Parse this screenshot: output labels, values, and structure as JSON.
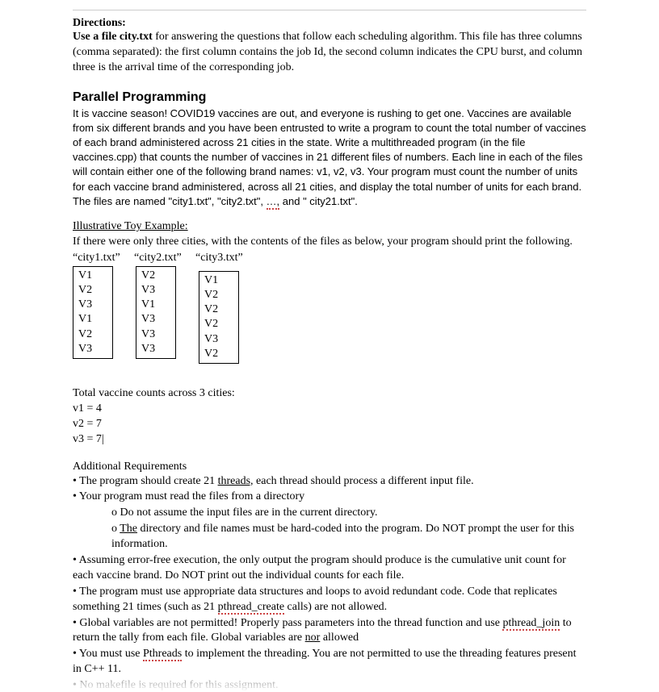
{
  "directions": {
    "heading": "Directions:",
    "body": "Use a file city.txt for answering the questions that follow each scheduling algorithm. This file has three columns (comma separated): the first column contains the job Id, the second column indicates the CPU burst, and column three is the arrival time of the corresponding job."
  },
  "section": {
    "title": "Parallel Programming",
    "body_a": "It is vaccine season! COVID19 vaccines are out, and everyone is rushing to get one. Vaccines are available from six different brands and you have been entrusted to write a program to count the total number of vaccines of each brand administered across 21 cities in the state. Write a multithreaded program (in the file vaccines.cpp) that counts the number of vaccines in 21 different files of numbers. Each line in each of the files will contain either one of the following brand names: v1, v2, v3. Your program must count the number of units for each vaccine brand administered, across all 21 cities, and display the total number of units for each brand. The files are named \"city1.txt\", \"city2.txt\", ",
    "body_ellipsis": "…,",
    "body_b": " and \" city21.txt\"."
  },
  "example": {
    "heading": "Illustrative Toy Example:",
    "intro": "If there were only three cities, with the contents of the files as below, your program should print the following.",
    "labels": [
      "“city1.txt”",
      "“city2.txt”",
      "“city3.txt”"
    ],
    "files": {
      "city1": [
        "V1",
        "V2",
        "V3",
        "V1",
        "V2",
        "V3"
      ],
      "city2": [
        "V2",
        "V3",
        "V1",
        "V3",
        "V3",
        "V3"
      ],
      "city3": [
        "V1",
        "V2",
        "V2",
        "V2",
        "V3",
        "V2"
      ]
    }
  },
  "totals": {
    "heading": "Total vaccine counts across 3 cities:",
    "lines": [
      "v1 = 4",
      "v2 = 7",
      "v3 = 7"
    ]
  },
  "addl": {
    "heading": "Additional Requirements",
    "r1_a": "• The program should create 21 ",
    "r1_thr": "threads,",
    "r1_b": " each thread should process a different input file.",
    "r2": "• Your program must read the files from a directory",
    "r2_o1": "o Do not assume the input files are in the current directory.",
    "r2_o2_a": "o ",
    "r2_o2_the": "The",
    "r2_o2_b": " directory and file names must be hard-coded into the program. Do NOT prompt the user for this information.",
    "r3": "• Assuming error-free execution, the only output the program should produce is the cumulative unit count for each vaccine brand. Do NOT print out the individual counts for each file.",
    "r4_a": "• The program must use appropriate data structures and loops to avoid redundant code. Code that replicates something 21 times (such as 21 ",
    "r4_pc": "pthread_create",
    "r4_b": " calls) are not allowed.",
    "r5_a": "• Global variables are not permitted! Properly pass parameters into the thread function and use ",
    "r5_pj": "pthread_join",
    "r5_b": " to return the tally from each file. Global variables are ",
    "r5_nor": "nor",
    "r5_c": " allowed",
    "r6_a": "• You must use ",
    "r6_pt": "Pthreads",
    "r6_b": " to implement the threading. You are not permitted to use the threading features present in C++ 11.",
    "cutoff": "• No makefile is required for this assignment."
  }
}
